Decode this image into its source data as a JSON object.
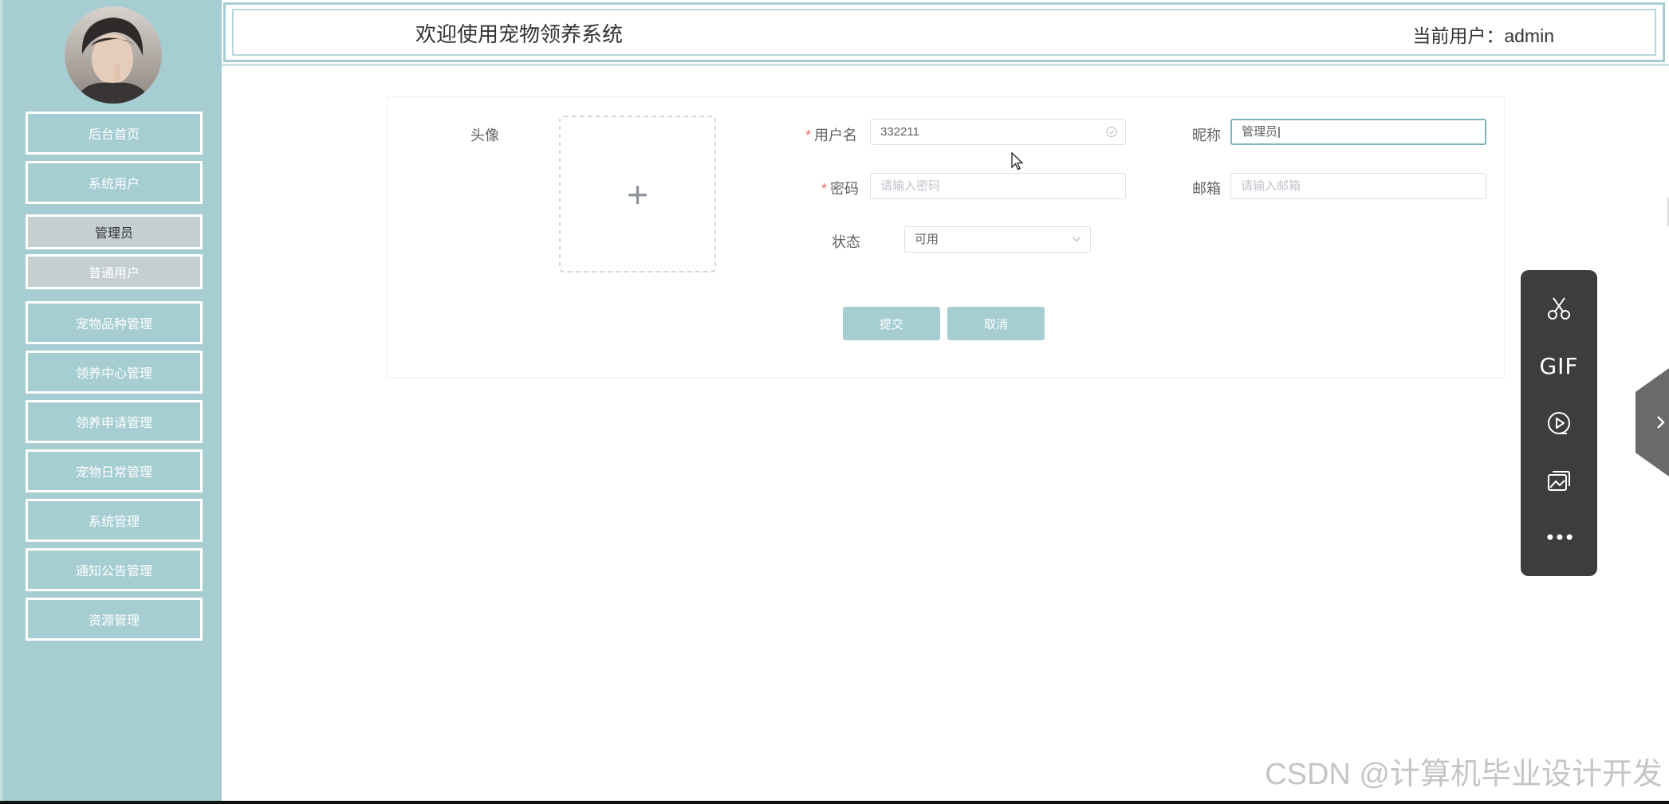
{
  "header": {
    "title": "欢迎使用宠物领养系统",
    "user_label": "当前用户：",
    "user_name": "admin"
  },
  "sidebar": {
    "items": [
      {
        "label": "后台首页"
      },
      {
        "label": "系统用户"
      },
      {
        "label": "宠物品种管理"
      },
      {
        "label": "领养中心管理"
      },
      {
        "label": "领养申请管理"
      },
      {
        "label": "宠物日常管理"
      },
      {
        "label": "系统管理"
      },
      {
        "label": "通知公告管理"
      },
      {
        "label": "资源管理"
      }
    ],
    "sub_items": [
      {
        "label": "管理员",
        "selected": true
      },
      {
        "label": "普通用户",
        "selected": false
      }
    ]
  },
  "form": {
    "avatar_label": "头像",
    "upload_plus": "+",
    "required_mark": "*",
    "username_label": "用户名",
    "username_value": "332211",
    "nickname_label": "昵称",
    "nickname_value": "管理员",
    "password_label": "密码",
    "password_placeholder": "请输入密码",
    "email_label": "邮箱",
    "email_placeholder": "请输入邮箱",
    "status_label": "状态",
    "status_value": "可用",
    "submit_label": "提交",
    "cancel_label": "取消"
  },
  "toolbar": {
    "gif_label": "GIF",
    "more_label": "•••"
  },
  "watermark": "CSDN @计算机毕业设计开发",
  "colors": {
    "accent": "#a5cdd2",
    "required": "#f56c6c",
    "toolbar_bg": "#3d3d3d"
  },
  "icons": {
    "username_suffix": "check-circle-icon",
    "status_suffix": "chevron-down-icon",
    "upload": "plus-icon",
    "toolbar": [
      "scissors-icon",
      "gif-icon",
      "record-icon",
      "screenshot-icon",
      "more-icon"
    ],
    "side_tab": "chevron-right-icon"
  }
}
